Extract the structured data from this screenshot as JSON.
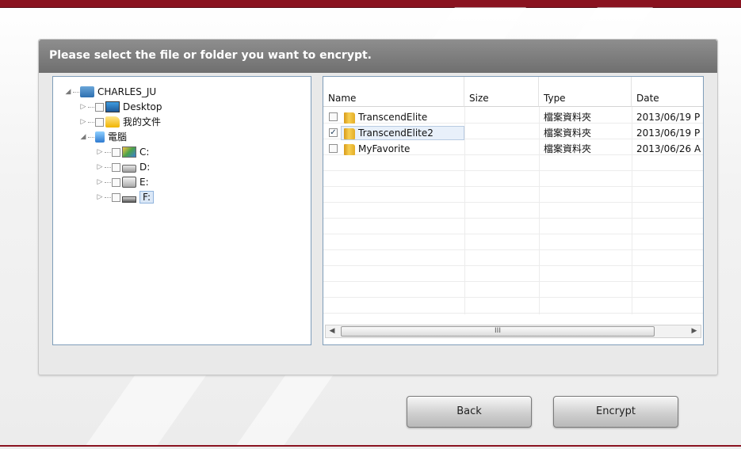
{
  "dialog": {
    "title": "Please select the file or folder you want to encrypt."
  },
  "tree": {
    "root_label": "CHARLES_JU",
    "desktop_label": "Desktop",
    "docs_label": "我的文件",
    "computer_label": "電腦",
    "drives": [
      {
        "label": "C:"
      },
      {
        "label": "D:"
      },
      {
        "label": "E:"
      },
      {
        "label": "F:"
      }
    ],
    "selected": "F:"
  },
  "file_list": {
    "columns": [
      "Name",
      "Size",
      "Type",
      "Date"
    ],
    "rows": [
      {
        "name": "TranscendElite",
        "size": "",
        "type": "檔案資料夾",
        "date": "2013/06/19 P",
        "checked": false
      },
      {
        "name": "TranscendElite2",
        "size": "",
        "type": "檔案資料夾",
        "date": "2013/06/19 P",
        "checked": true
      },
      {
        "name": "MyFavorite",
        "size": "",
        "type": "檔案資料夾",
        "date": "2013/06/26 A",
        "checked": false
      }
    ],
    "scroll_grip": "III"
  },
  "buttons": {
    "back": "Back",
    "encrypt": "Encrypt"
  },
  "colors": {
    "accent": "#8a1320",
    "header": "#7a7a7a"
  }
}
